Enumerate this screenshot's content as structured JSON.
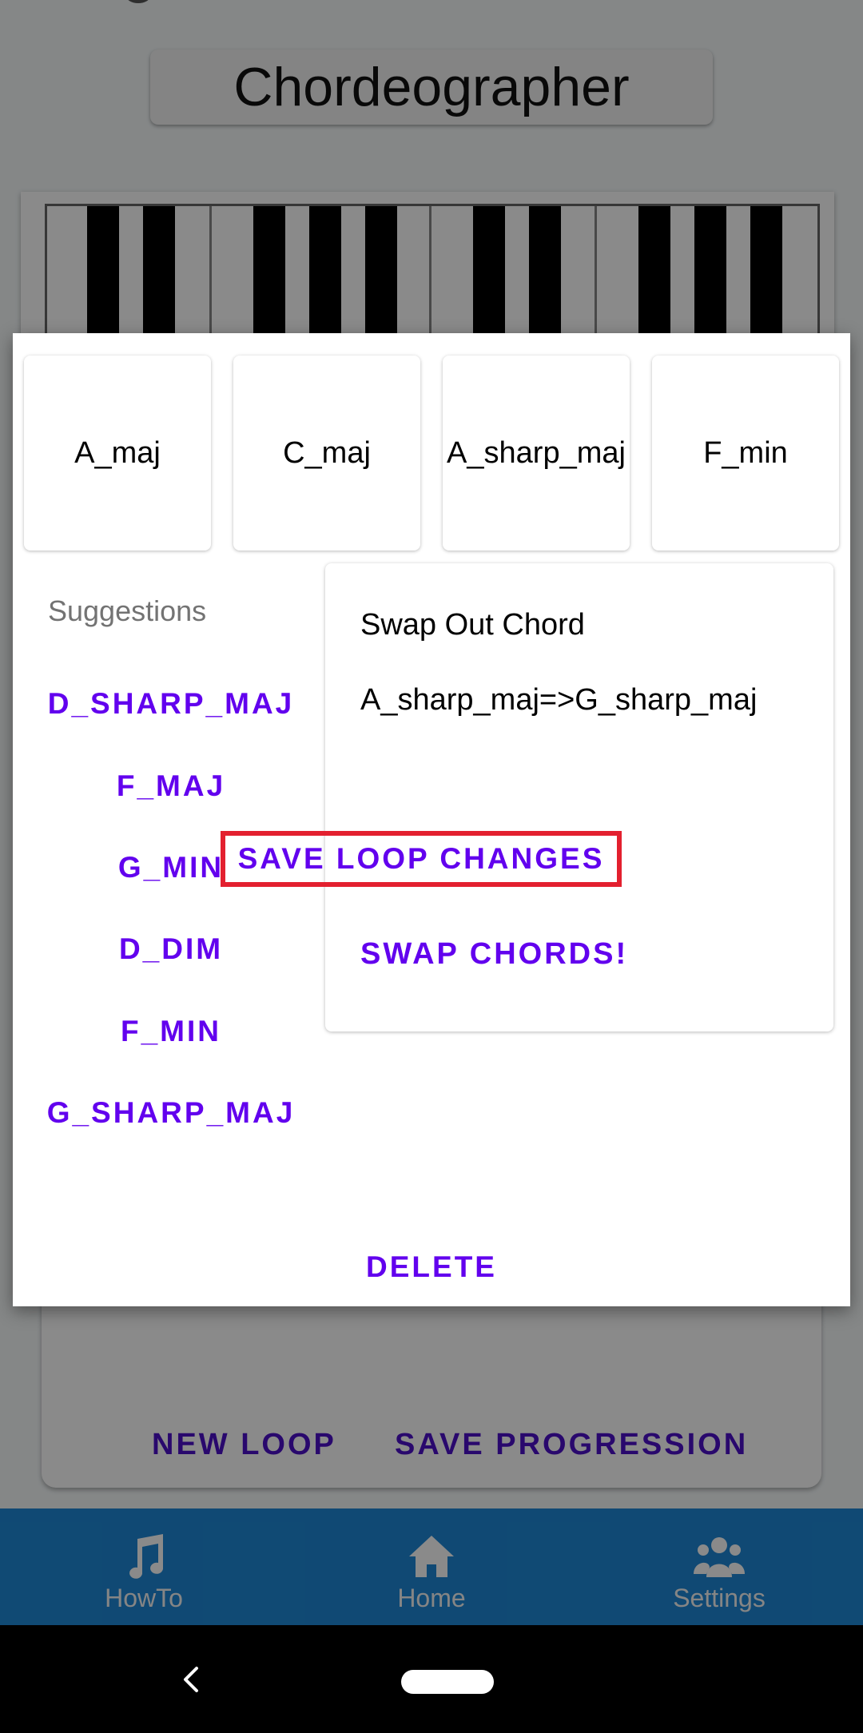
{
  "app": {
    "title": "Chordeographer",
    "actions": {
      "new_loop": "NEW LOOP",
      "save_progression": "SAVE PROGRESSION"
    },
    "nav": [
      {
        "label": "HowTo",
        "icon": "music-note-icon"
      },
      {
        "label": "Home",
        "icon": "home-icon"
      },
      {
        "label": "Settings",
        "icon": "users-icon"
      }
    ],
    "nav_color": "#1e88d6"
  },
  "dialog": {
    "chords": [
      "A_maj",
      "C_maj",
      "A_sharp_maj",
      "F_min"
    ],
    "suggestions_label": "Suggestions",
    "suggestions": [
      "D_SHARP_MAJ",
      "F_MAJ",
      "G_MIN",
      "D_DIM",
      "F_MIN",
      "G_SHARP_MAJ"
    ],
    "swap": {
      "title": "Swap Out Chord",
      "detail": "A_sharp_maj=>G_sharp_maj",
      "button": "SWAP CHORDS!"
    },
    "save_loop": "SAVE LOOP CHANGES",
    "delete": "DELETE",
    "accent_color": "#6200ee",
    "highlight_color": "#e3202f"
  }
}
